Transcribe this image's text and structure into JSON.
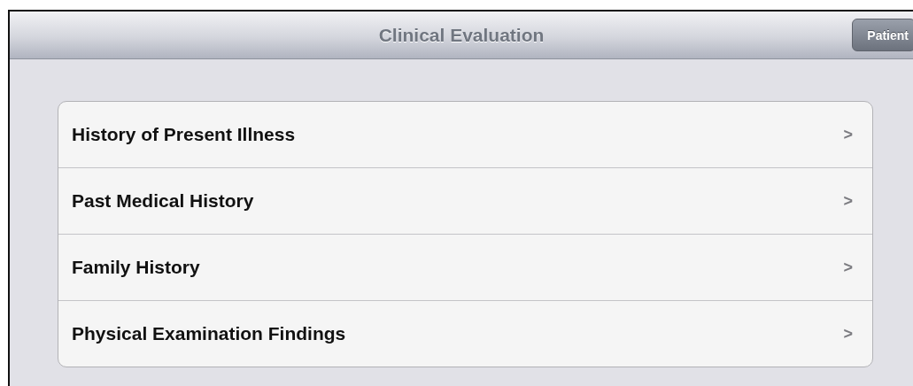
{
  "nav_bar": {
    "title": "Clinical Evaluation",
    "right_button": "Patient"
  },
  "menu": [
    {
      "label": "History of Present Illness",
      "chevron": ">"
    },
    {
      "label": "Past Medical History",
      "chevron": ">"
    },
    {
      "label": "Family History",
      "chevron": ">"
    },
    {
      "label": "Physical Examination Findings",
      "chevron": ">"
    }
  ]
}
